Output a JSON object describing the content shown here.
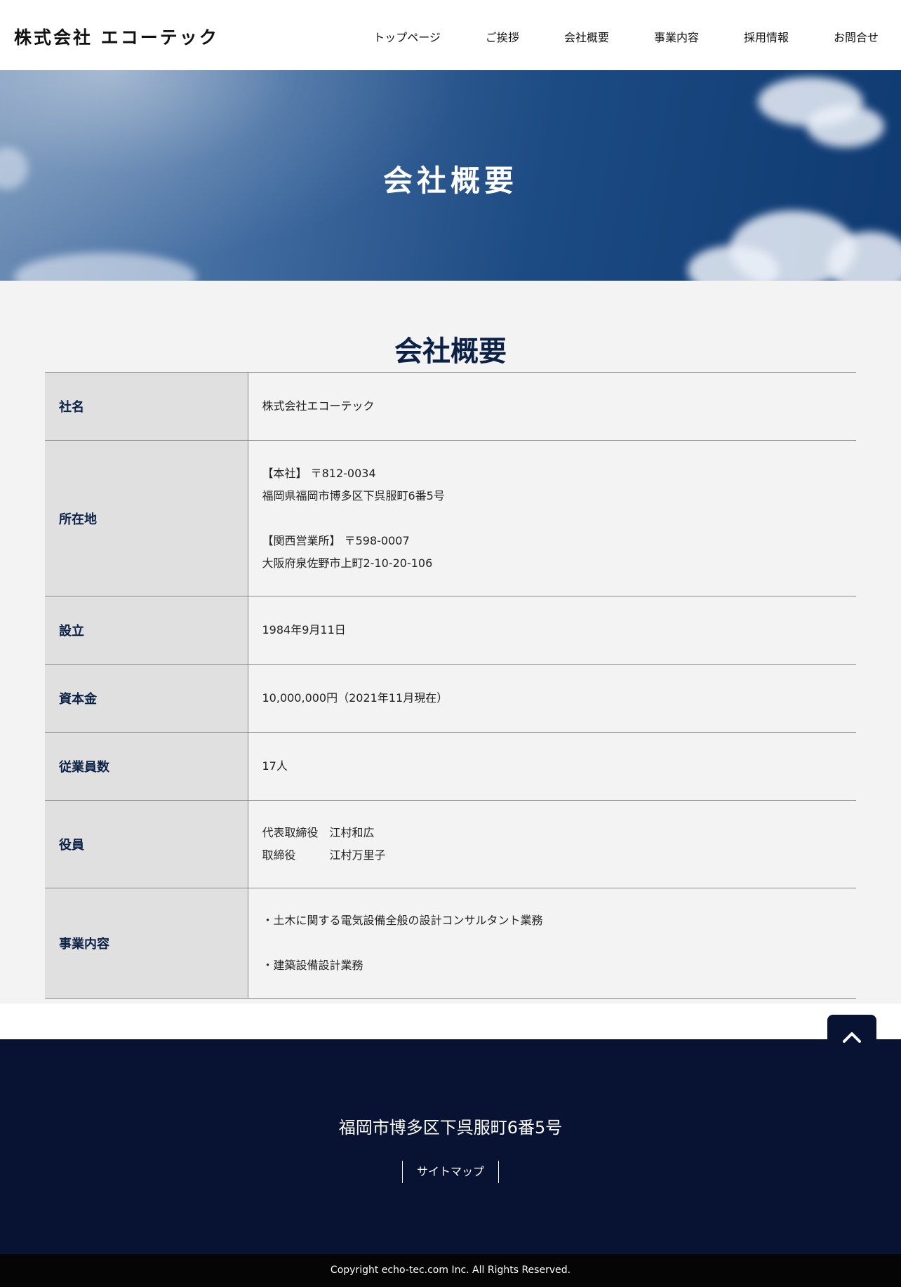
{
  "header": {
    "logo": "株式会社 エコーテック",
    "nav": [
      "トップページ",
      "ご挨拶",
      "会社概要",
      "事業内容",
      "採用情報",
      "お問合せ"
    ]
  },
  "hero": {
    "title": "会社概要"
  },
  "main": {
    "title": "会社概要",
    "rows": {
      "name": {
        "label": "社名",
        "value": "株式会社エコーテック"
      },
      "address": {
        "label": "所在地",
        "hq_line1": "【本社】 〒812-0034",
        "hq_line2": "福岡県福岡市博多区下呉服町6番5号",
        "branch_line1": "【関西営業所】 〒598-0007",
        "branch_line2": "大阪府泉佐野市上町2-10-20-106"
      },
      "founded": {
        "label": "設立",
        "value": "1984年9月11日"
      },
      "capital": {
        "label": "資本金",
        "value": "10,000,000円（2021年11月現在）"
      },
      "employees": {
        "label": "従業員数",
        "value": "17人"
      },
      "officers": {
        "label": "役員",
        "r1_title": "代表取締役",
        "r1_name": "江村和広",
        "r2_title": "取締役",
        "r2_name": "江村万里子"
      },
      "business": {
        "label": "事業内容",
        "item1": "・土木に関する電気設備全般の設計コンサルタント業務",
        "item2": "・建築設備設計業務"
      }
    }
  },
  "footer": {
    "address": "福岡市博多区下呉服町6番5号",
    "sitemap": "サイトマップ",
    "copyright": "Copyright echo-tec.com Inc. All Rights Reserved."
  },
  "icons": {
    "back_to_top": "chevron-up-icon"
  },
  "colors": {
    "navy": "#0b2146",
    "footer_bg": "#081233",
    "table_label_bg": "#e0e0e0",
    "main_bg": "#f3f3f3"
  }
}
